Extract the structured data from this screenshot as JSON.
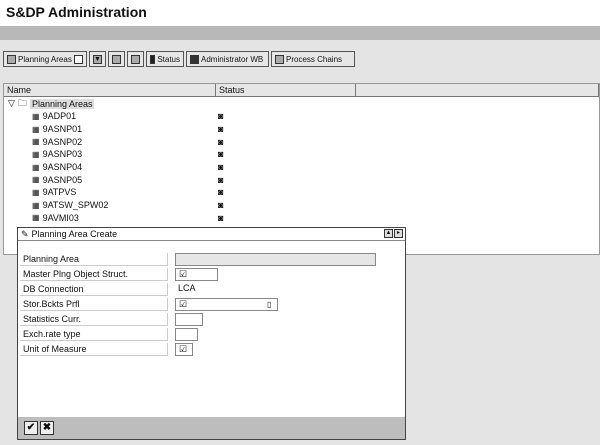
{
  "window": {
    "title": "S&DP Administration"
  },
  "toolbar": {
    "planning_areas": "Planning Areas",
    "status": "Status",
    "admin_wb": "Administrator WB",
    "process_chains": "Process Chains"
  },
  "tree": {
    "columns": [
      "Name",
      "Status"
    ],
    "root": "Planning Areas",
    "items": [
      "9ADP01",
      "9ASNP01",
      "9ASNP02",
      "9ASNP03",
      "9ASNP04",
      "9ASNP05",
      "9ATPVS",
      "9ATSW_SPW02",
      "9AVMI03"
    ]
  },
  "dialog": {
    "title": "Planning Area  Create",
    "fields": [
      {
        "label": "Planning Area",
        "value": ""
      },
      {
        "label": "Master Plng Object Struct.",
        "value": "☑"
      },
      {
        "label": "DB Connection",
        "value": "LCA"
      },
      {
        "label": "Stor.Bckts Prfl",
        "value": "☑"
      },
      {
        "label": "Statistics Curr.",
        "value": ""
      },
      {
        "label": "Exch.rate type",
        "value": ""
      },
      {
        "label": "Unit of Measure",
        "value": "☑"
      }
    ],
    "ok": "✔",
    "cancel": "✖"
  }
}
